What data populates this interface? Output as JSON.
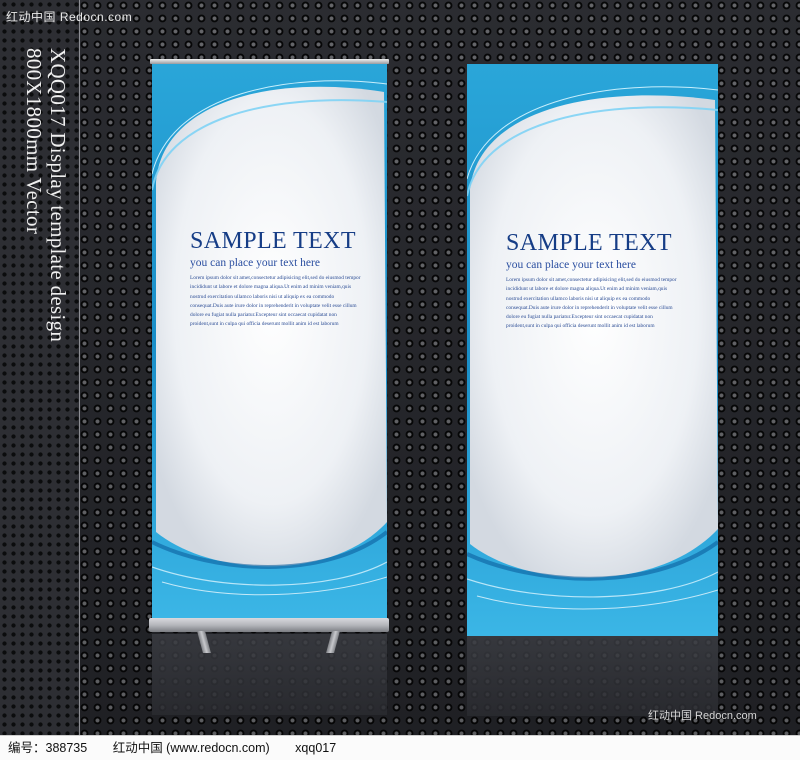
{
  "watermark": {
    "top": "红动中国 Redocn.com",
    "bottom": "红动中国 Redocn.com"
  },
  "side_text": {
    "line1": "XQQ017 Display template design",
    "line2": "800X1800mm Vector"
  },
  "banner": {
    "title": "SAMPLE TEXT",
    "subtitle": "you can place your text here",
    "body": [
      "Lorem ipsum dolor sit amet,consectetur adipisicing elit,sed do eiusmod tempor",
      "incididunt ut labore et dolore magna aliqua.Ut enim ad minim veniam,quis",
      "nostrud exercitation ullamco laboris nisi ut aliquip ex ea commodo",
      "consequat.Duis aute irure dolor in reprehenderit in voluptate velit esse cillum",
      "dolore eu fugiat nulla pariatur.Excepteur sint occaecat cupidatat non",
      "proident,sunt in culpa qui officia deserunt mollit anim id est laborum"
    ]
  },
  "footer": {
    "id_label": "编号：388735",
    "site": "红动中国 (www.redocn.com)",
    "author": "xqq017"
  },
  "colors": {
    "banner_blue": "#1a8ec8",
    "title_navy": "#163d86"
  }
}
